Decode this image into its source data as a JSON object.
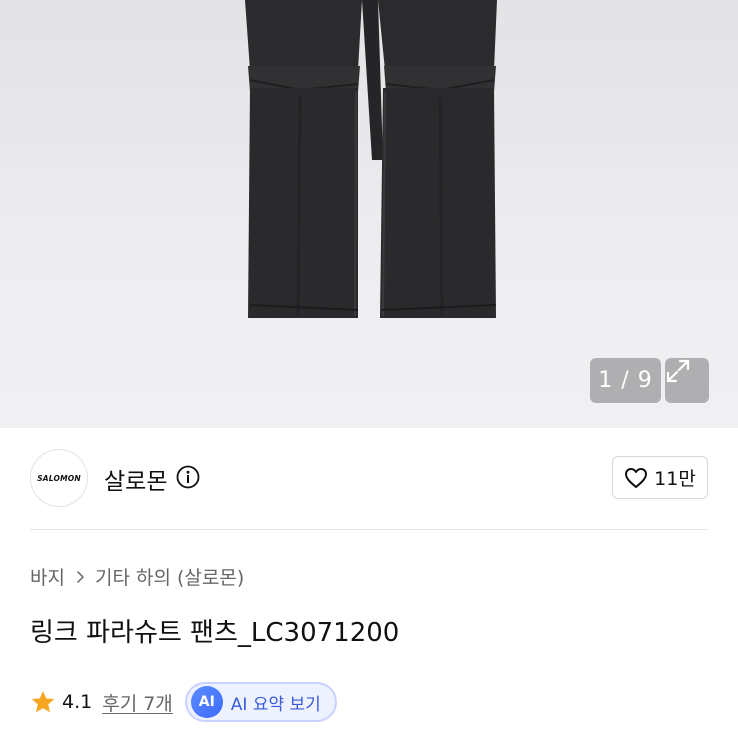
{
  "gallery": {
    "counter": "1 / 9",
    "product_image": "black-cargo-pants"
  },
  "brand": {
    "logo_text": "SALOMON",
    "name": "살로몬",
    "likes": "11만"
  },
  "breadcrumb": {
    "category": "바지",
    "subcategory": "기타 하의 (살로몬)"
  },
  "product": {
    "title": "링크 파라슈트 팬츠_LC3071200"
  },
  "rating": {
    "score": "4.1",
    "reviews": "후기 7개",
    "ai_badge": "AI",
    "ai_summary": "AI 요약 보기"
  },
  "colors": {
    "star": "#f5a623",
    "ai_accent": "#3d6bff"
  }
}
